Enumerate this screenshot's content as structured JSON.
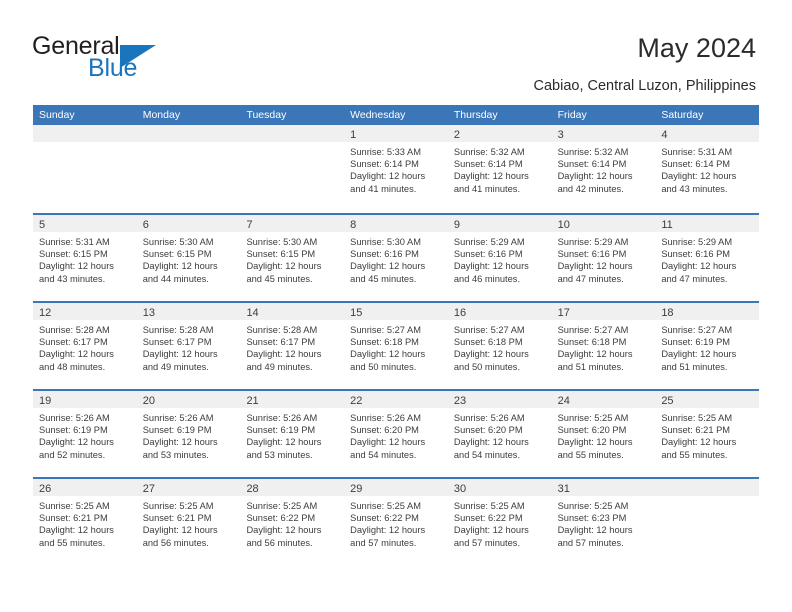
{
  "brand": {
    "name_part1": "General",
    "name_part2": "Blue"
  },
  "header": {
    "title": "May 2024",
    "subtitle": "Cabiao, Central Luzon, Philippines"
  },
  "colors": {
    "header_blue": "#3a76b8",
    "brand_blue": "#1b75bc",
    "day_band_gray": "#f0f0f0",
    "text": "#3d3d3d"
  },
  "weekdays": [
    "Sunday",
    "Monday",
    "Tuesday",
    "Wednesday",
    "Thursday",
    "Friday",
    "Saturday"
  ],
  "weeks": [
    [
      {
        "day": "",
        "empty": true,
        "sunrise": "",
        "sunset": "",
        "daylight1": "",
        "daylight2": ""
      },
      {
        "day": "",
        "empty": true,
        "sunrise": "",
        "sunset": "",
        "daylight1": "",
        "daylight2": ""
      },
      {
        "day": "",
        "empty": true,
        "sunrise": "",
        "sunset": "",
        "daylight1": "",
        "daylight2": ""
      },
      {
        "day": "1",
        "empty": false,
        "sunrise": "Sunrise: 5:33 AM",
        "sunset": "Sunset: 6:14 PM",
        "daylight1": "Daylight: 12 hours",
        "daylight2": "and 41 minutes."
      },
      {
        "day": "2",
        "empty": false,
        "sunrise": "Sunrise: 5:32 AM",
        "sunset": "Sunset: 6:14 PM",
        "daylight1": "Daylight: 12 hours",
        "daylight2": "and 41 minutes."
      },
      {
        "day": "3",
        "empty": false,
        "sunrise": "Sunrise: 5:32 AM",
        "sunset": "Sunset: 6:14 PM",
        "daylight1": "Daylight: 12 hours",
        "daylight2": "and 42 minutes."
      },
      {
        "day": "4",
        "empty": false,
        "sunrise": "Sunrise: 5:31 AM",
        "sunset": "Sunset: 6:14 PM",
        "daylight1": "Daylight: 12 hours",
        "daylight2": "and 43 minutes."
      }
    ],
    [
      {
        "day": "5",
        "empty": false,
        "sunrise": "Sunrise: 5:31 AM",
        "sunset": "Sunset: 6:15 PM",
        "daylight1": "Daylight: 12 hours",
        "daylight2": "and 43 minutes."
      },
      {
        "day": "6",
        "empty": false,
        "sunrise": "Sunrise: 5:30 AM",
        "sunset": "Sunset: 6:15 PM",
        "daylight1": "Daylight: 12 hours",
        "daylight2": "and 44 minutes."
      },
      {
        "day": "7",
        "empty": false,
        "sunrise": "Sunrise: 5:30 AM",
        "sunset": "Sunset: 6:15 PM",
        "daylight1": "Daylight: 12 hours",
        "daylight2": "and 45 minutes."
      },
      {
        "day": "8",
        "empty": false,
        "sunrise": "Sunrise: 5:30 AM",
        "sunset": "Sunset: 6:16 PM",
        "daylight1": "Daylight: 12 hours",
        "daylight2": "and 45 minutes."
      },
      {
        "day": "9",
        "empty": false,
        "sunrise": "Sunrise: 5:29 AM",
        "sunset": "Sunset: 6:16 PM",
        "daylight1": "Daylight: 12 hours",
        "daylight2": "and 46 minutes."
      },
      {
        "day": "10",
        "empty": false,
        "sunrise": "Sunrise: 5:29 AM",
        "sunset": "Sunset: 6:16 PM",
        "daylight1": "Daylight: 12 hours",
        "daylight2": "and 47 minutes."
      },
      {
        "day": "11",
        "empty": false,
        "sunrise": "Sunrise: 5:29 AM",
        "sunset": "Sunset: 6:16 PM",
        "daylight1": "Daylight: 12 hours",
        "daylight2": "and 47 minutes."
      }
    ],
    [
      {
        "day": "12",
        "empty": false,
        "sunrise": "Sunrise: 5:28 AM",
        "sunset": "Sunset: 6:17 PM",
        "daylight1": "Daylight: 12 hours",
        "daylight2": "and 48 minutes."
      },
      {
        "day": "13",
        "empty": false,
        "sunrise": "Sunrise: 5:28 AM",
        "sunset": "Sunset: 6:17 PM",
        "daylight1": "Daylight: 12 hours",
        "daylight2": "and 49 minutes."
      },
      {
        "day": "14",
        "empty": false,
        "sunrise": "Sunrise: 5:28 AM",
        "sunset": "Sunset: 6:17 PM",
        "daylight1": "Daylight: 12 hours",
        "daylight2": "and 49 minutes."
      },
      {
        "day": "15",
        "empty": false,
        "sunrise": "Sunrise: 5:27 AM",
        "sunset": "Sunset: 6:18 PM",
        "daylight1": "Daylight: 12 hours",
        "daylight2": "and 50 minutes."
      },
      {
        "day": "16",
        "empty": false,
        "sunrise": "Sunrise: 5:27 AM",
        "sunset": "Sunset: 6:18 PM",
        "daylight1": "Daylight: 12 hours",
        "daylight2": "and 50 minutes."
      },
      {
        "day": "17",
        "empty": false,
        "sunrise": "Sunrise: 5:27 AM",
        "sunset": "Sunset: 6:18 PM",
        "daylight1": "Daylight: 12 hours",
        "daylight2": "and 51 minutes."
      },
      {
        "day": "18",
        "empty": false,
        "sunrise": "Sunrise: 5:27 AM",
        "sunset": "Sunset: 6:19 PM",
        "daylight1": "Daylight: 12 hours",
        "daylight2": "and 51 minutes."
      }
    ],
    [
      {
        "day": "19",
        "empty": false,
        "sunrise": "Sunrise: 5:26 AM",
        "sunset": "Sunset: 6:19 PM",
        "daylight1": "Daylight: 12 hours",
        "daylight2": "and 52 minutes."
      },
      {
        "day": "20",
        "empty": false,
        "sunrise": "Sunrise: 5:26 AM",
        "sunset": "Sunset: 6:19 PM",
        "daylight1": "Daylight: 12 hours",
        "daylight2": "and 53 minutes."
      },
      {
        "day": "21",
        "empty": false,
        "sunrise": "Sunrise: 5:26 AM",
        "sunset": "Sunset: 6:19 PM",
        "daylight1": "Daylight: 12 hours",
        "daylight2": "and 53 minutes."
      },
      {
        "day": "22",
        "empty": false,
        "sunrise": "Sunrise: 5:26 AM",
        "sunset": "Sunset: 6:20 PM",
        "daylight1": "Daylight: 12 hours",
        "daylight2": "and 54 minutes."
      },
      {
        "day": "23",
        "empty": false,
        "sunrise": "Sunrise: 5:26 AM",
        "sunset": "Sunset: 6:20 PM",
        "daylight1": "Daylight: 12 hours",
        "daylight2": "and 54 minutes."
      },
      {
        "day": "24",
        "empty": false,
        "sunrise": "Sunrise: 5:25 AM",
        "sunset": "Sunset: 6:20 PM",
        "daylight1": "Daylight: 12 hours",
        "daylight2": "and 55 minutes."
      },
      {
        "day": "25",
        "empty": false,
        "sunrise": "Sunrise: 5:25 AM",
        "sunset": "Sunset: 6:21 PM",
        "daylight1": "Daylight: 12 hours",
        "daylight2": "and 55 minutes."
      }
    ],
    [
      {
        "day": "26",
        "empty": false,
        "sunrise": "Sunrise: 5:25 AM",
        "sunset": "Sunset: 6:21 PM",
        "daylight1": "Daylight: 12 hours",
        "daylight2": "and 55 minutes."
      },
      {
        "day": "27",
        "empty": false,
        "sunrise": "Sunrise: 5:25 AM",
        "sunset": "Sunset: 6:21 PM",
        "daylight1": "Daylight: 12 hours",
        "daylight2": "and 56 minutes."
      },
      {
        "day": "28",
        "empty": false,
        "sunrise": "Sunrise: 5:25 AM",
        "sunset": "Sunset: 6:22 PM",
        "daylight1": "Daylight: 12 hours",
        "daylight2": "and 56 minutes."
      },
      {
        "day": "29",
        "empty": false,
        "sunrise": "Sunrise: 5:25 AM",
        "sunset": "Sunset: 6:22 PM",
        "daylight1": "Daylight: 12 hours",
        "daylight2": "and 57 minutes."
      },
      {
        "day": "30",
        "empty": false,
        "sunrise": "Sunrise: 5:25 AM",
        "sunset": "Sunset: 6:22 PM",
        "daylight1": "Daylight: 12 hours",
        "daylight2": "and 57 minutes."
      },
      {
        "day": "31",
        "empty": false,
        "sunrise": "Sunrise: 5:25 AM",
        "sunset": "Sunset: 6:23 PM",
        "daylight1": "Daylight: 12 hours",
        "daylight2": "and 57 minutes."
      },
      {
        "day": "",
        "empty": true,
        "sunrise": "",
        "sunset": "",
        "daylight1": "",
        "daylight2": ""
      }
    ]
  ]
}
